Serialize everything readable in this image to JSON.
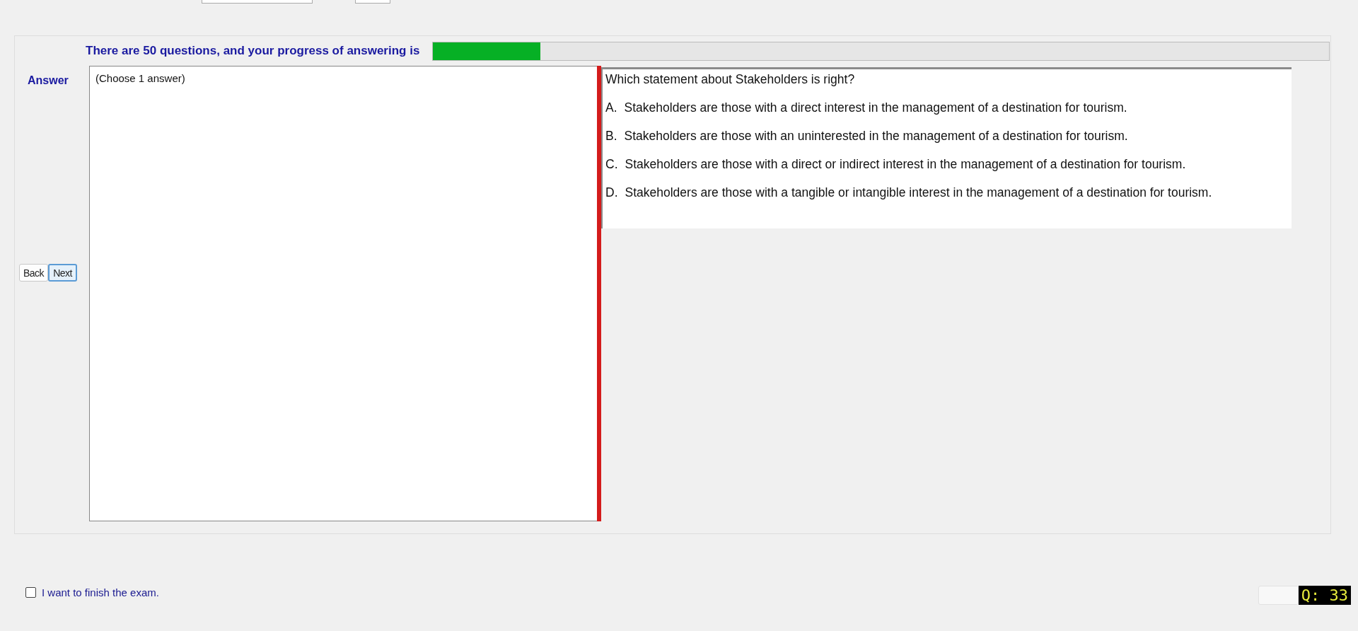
{
  "progress": {
    "label": "There are 50 questions, and your progress of answering is",
    "level": 0.12
  },
  "answer": {
    "label": "Answer",
    "instruction": "(Choose 1 answer)"
  },
  "navigation": [
    "Back",
    "Next"
  ],
  "question": {
    "text": "Which statement about Stakeholders is right?",
    "options": [
      {
        "letter": "A.",
        "text": "Stakeholders are those with a direct interest in the management of a destination for tourism."
      },
      {
        "letter": "B.",
        "text": "Stakeholders are those with an uninterested in the management of a destination for tourism."
      },
      {
        "letter": "C.",
        "text": "Stakeholders are those with a direct or indirect interest in the management of a destination for tourism."
      },
      {
        "letter": "D.",
        "text": "Stakeholders are those with a tangible or intangible interest in the management of a destination for tourism."
      }
    ]
  },
  "finish": {
    "label": "I want to finish the exam.",
    "checked": false
  },
  "question_counter": "Q: 33"
}
